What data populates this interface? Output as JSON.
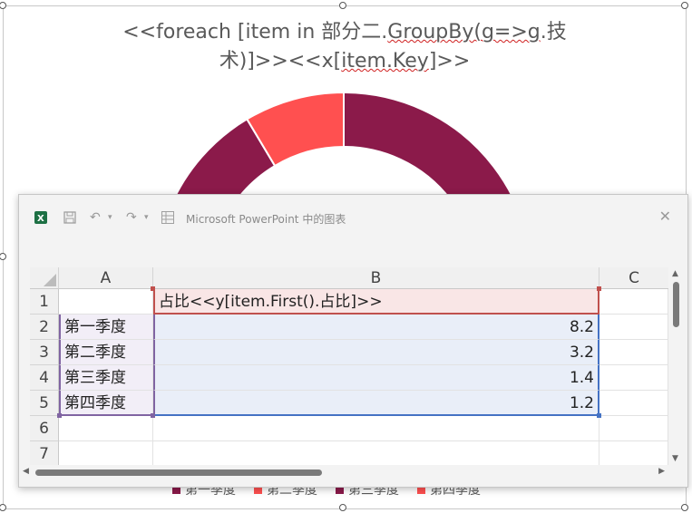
{
  "chart": {
    "title_line1_prefix": "<<foreach [item in 部分二.",
    "title_line1_squig": "GroupBy(g=>g",
    "title_line1_suffix": ".技",
    "title_line2_prefix": "术)]>><<x[",
    "title_line2_squig": "item.Key",
    "title_line2_suffix": "]>>",
    "legend": [
      {
        "label": "第一季度",
        "color": "#8B1A4A"
      },
      {
        "label": "第二季度",
        "color": "#FF5050"
      },
      {
        "label": "第三季度",
        "color": "#8B1A4A"
      },
      {
        "label": "第四季度",
        "color": "#FF5050"
      }
    ]
  },
  "chart_data": {
    "type": "pie",
    "categories": [
      "第一季度",
      "第二季度",
      "第三季度",
      "第四季度"
    ],
    "values": [
      8.2,
      3.2,
      1.4,
      1.2
    ],
    "colors": [
      "#8B1A4A",
      "#FF5050",
      "#8B1A4A",
      "#FF5050"
    ],
    "donut": true
  },
  "excel": {
    "window_title": "Microsoft PowerPoint 中的图表",
    "icons": {
      "app": "excel-icon",
      "save": "save-icon",
      "undo": "undo-icon",
      "redo": "redo-icon",
      "table": "table-icon",
      "close": "close-icon"
    },
    "columns": [
      "A",
      "B",
      "C"
    ],
    "rows": [
      "1",
      "2",
      "3",
      "4",
      "5",
      "6",
      "7"
    ],
    "header_cell": "占比<<y[item.First().占比]>>",
    "data_rows": [
      {
        "a": "第一季度",
        "b": "8.2"
      },
      {
        "a": "第二季度",
        "b": "3.2"
      },
      {
        "a": "第三季度",
        "b": "1.4"
      },
      {
        "a": "第四季度",
        "b": "1.2"
      }
    ]
  }
}
